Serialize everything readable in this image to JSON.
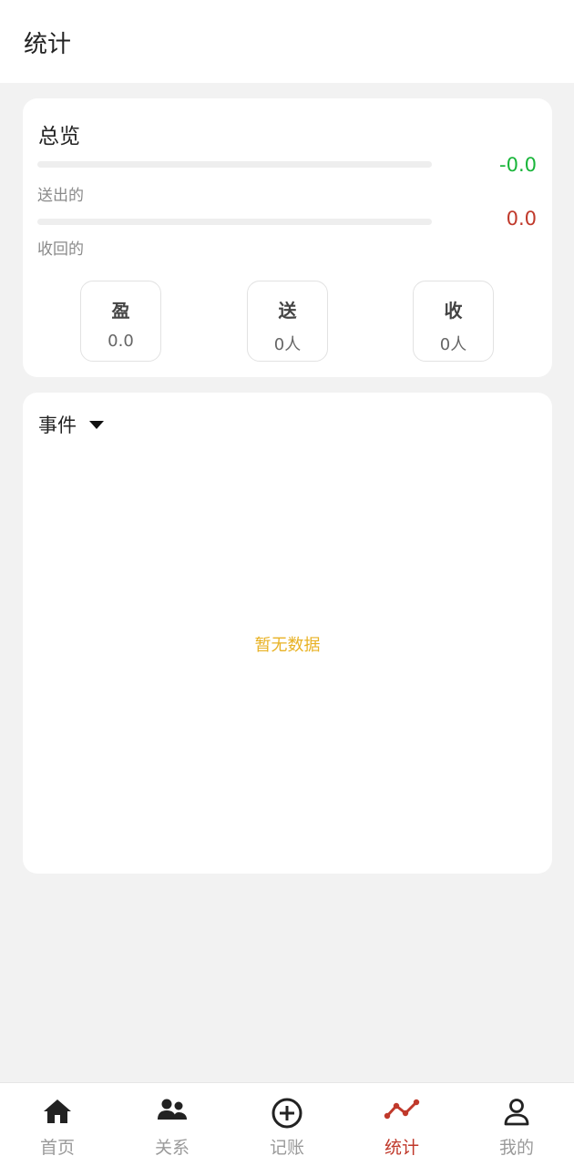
{
  "header": {
    "title": "统计"
  },
  "overview": {
    "title": "总览",
    "sent": {
      "label": "送出的",
      "value": "-0.0",
      "progress": 0
    },
    "received": {
      "label": "收回的",
      "value": "0.0",
      "progress": 0
    },
    "stats": [
      {
        "title": "盈",
        "value": "0.0"
      },
      {
        "title": "送",
        "value": "0人"
      },
      {
        "title": "收",
        "value": "0人"
      }
    ]
  },
  "events": {
    "dropdown_label": "事件",
    "empty_text": "暂无数据"
  },
  "tabbar": {
    "items": [
      {
        "label": "首页",
        "icon": "home-icon"
      },
      {
        "label": "关系",
        "icon": "people-icon"
      },
      {
        "label": "记账",
        "icon": "plus-circle-icon"
      },
      {
        "label": "统计",
        "icon": "trend-icon",
        "active": true
      },
      {
        "label": "我的",
        "icon": "user-icon"
      }
    ]
  },
  "colors": {
    "accent": "#c0392b",
    "positive": "#19b53a",
    "empty_text": "#e8b225"
  }
}
